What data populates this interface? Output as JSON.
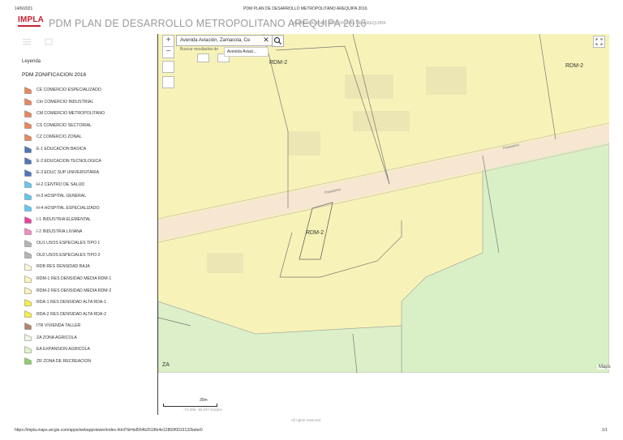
{
  "print_header": {
    "date": "14/6/2021",
    "title": "PDM PLAN DE DESARROLLO METROPOLITANO AREQUIPA 2016"
  },
  "app": {
    "logo_text": "IMPLA",
    "title": "PDM PLAN DE DESARROLLO METROPOLITANO AREQUIPA 2016",
    "subtitle": "MUNICIPALIDAD PROVINCIAL DE AREQUIPA"
  },
  "legend": {
    "heading": "Leyenda",
    "layer_title": "PDM ZONIFICACION 2016",
    "items": [
      {
        "label": "CE COMERCIO ESPECIALIZADO",
        "color": "#e8875f"
      },
      {
        "label": "CIn COMERCIO INDUSTRIAL",
        "color": "#e8875f"
      },
      {
        "label": "CM COMERCIO METROPOLITANO",
        "color": "#e8875f"
      },
      {
        "label": "CS COMERCIO SECTORIAL",
        "color": "#e8875f"
      },
      {
        "label": "CZ COMERCIO ZONAL",
        "color": "#e8875f"
      },
      {
        "label": "E-1 EDUCACION BASICA",
        "color": "#4f77b8"
      },
      {
        "label": "E-2 EDUCACION TECNOLOGICA",
        "color": "#4f77b8"
      },
      {
        "label": "E-3 EDUC SUP UNIVERSITARIA",
        "color": "#4f77b8"
      },
      {
        "label": "H-2 CENTRO DE SALUD",
        "color": "#63c8ef"
      },
      {
        "label": "H-3 HOSPITAL GENERAL",
        "color": "#63c8ef"
      },
      {
        "label": "H-4 HOSPITAL ESPECIALIZADO",
        "color": "#63c8ef"
      },
      {
        "label": "I-1 INDUSTRIA ELEMENTAL",
        "color": "#ec3fa0"
      },
      {
        "label": "I-2 INDUSTRIA LIVIANA",
        "color": "#f28ac4"
      },
      {
        "label": "OU1 USOS ESPECIALES TIPO 1",
        "color": "#b5b5b5"
      },
      {
        "label": "OU2 USOS ESPECIALES TIPO 2",
        "color": "#b5b5b5"
      },
      {
        "label": "RDB RES DENSIDAD BAJA",
        "color": "#fbf7d6"
      },
      {
        "label": "RDM-1 RES DENSIDAD MEDIA RDM-1",
        "color": "#fbf3b8"
      },
      {
        "label": "RDM-2 RES DENSIDAD MEDIA RDM-2",
        "color": "#fbf3b8"
      },
      {
        "label": "RDA-1 RES DENSIDAD ALTA RDA-1",
        "color": "#f6ee4a"
      },
      {
        "label": "RDA-2 RES DENSIDAD ALTA RDA-2",
        "color": "#f6ee4a"
      },
      {
        "label": "ITR VIVIENDA TALLER",
        "color": "#b5836a"
      },
      {
        "label": "ZA ZONA AGRICOLA",
        "color": "#eef7e0"
      },
      {
        "label": "EA EXPANSION AGRICOLA",
        "color": "#dff2cc"
      },
      {
        "label": "ZR ZONA DE RECREACION",
        "color": "#8fcf6c"
      }
    ]
  },
  "map": {
    "zoom_in": "+",
    "zoom_out": "−",
    "search_value": "Avenida Aviación, Zamacola, Ce",
    "search_hint": "Buscar resultados de",
    "suggestion": "Avenida Aviaci...",
    "labels": {
      "rdm2_top_left": "RDM-2",
      "rdm2_top_right": "RDM-2",
      "rdm2_center": "RDM-2",
      "za": "ZA",
      "street": "Pasaaneo"
    },
    "attribution": "Maps",
    "zone_colors": {
      "rdm2": "#f7f3b8",
      "agricola": "#d9f0c6",
      "road": "#f6e6d2"
    }
  },
  "scale": {
    "label": "30m",
    "coords": "-71.556 -16.347 Grados"
  },
  "footer": {
    "rights": "All rights reserved",
    "url": "https://impla.maps.arcgis.com/apps/webappviewer/index.html?id=bd564b2619fe4e12850f0019132bebe0",
    "page": "1/1"
  }
}
